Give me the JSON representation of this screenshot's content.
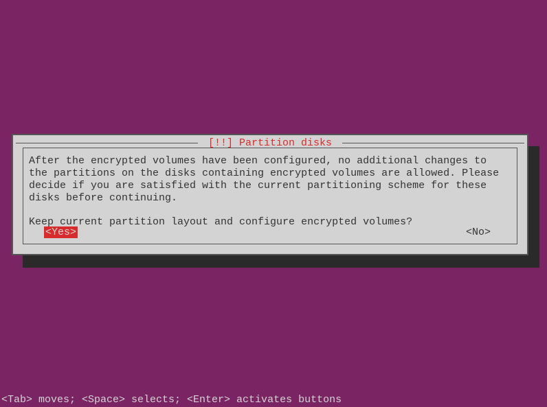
{
  "dialog": {
    "title": " [!!] Partition disks ",
    "body_line1": "After the encrypted volumes have been configured, no additional changes to the partitions on the disks containing encrypted volumes are allowed. Please decide if you are satisfied with the current partitioning scheme for these disks before continuing.",
    "body_line2": "Keep current partition layout and configure encrypted volumes?",
    "yes_label": "<Yes>",
    "no_label": "<No>"
  },
  "help_bar": "<Tab> moves; <Space> selects; <Enter> activates buttons"
}
